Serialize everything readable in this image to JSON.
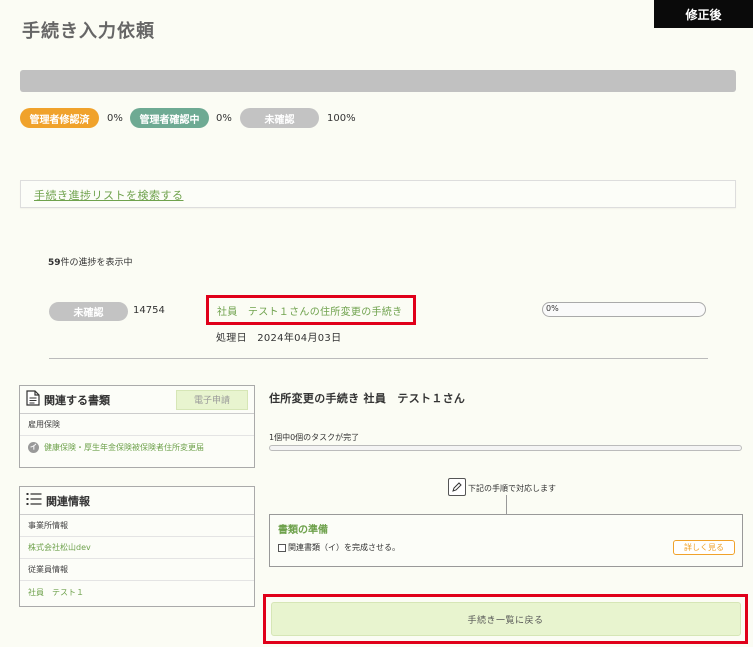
{
  "header": {
    "corner_label": "修正後",
    "page_title": "手続き入力依頼"
  },
  "progress": {
    "overall_fraction": 0,
    "statuses": [
      {
        "label": "管理者修認済",
        "percent": "0%",
        "color": "#f0a22b"
      },
      {
        "label": "管理者確認中",
        "percent": "0%",
        "color": "#6eaa93"
      },
      {
        "label": "未確認",
        "percent": "100%",
        "color": "#c3c3c3"
      }
    ]
  },
  "search": {
    "link_label": "手続き進捗リストを検索する"
  },
  "list": {
    "count": "59",
    "count_suffix": "件の進捗を表示中",
    "rows": [
      {
        "status": "未確認",
        "id": "14754",
        "title": "社員　テスト１さんの住所変更の手続き",
        "date": "処理日　2024年04月03日",
        "progress_label": "0%",
        "progress_fraction": 0
      }
    ]
  },
  "documents_panel": {
    "title": "関連する書類",
    "esign_label": "電子申請",
    "items": [
      {
        "label": "雇用保険",
        "style": "gray"
      },
      {
        "label": "健康保険・厚生年金保険被保険者住所変更届",
        "style": "green",
        "badge": "イ"
      }
    ]
  },
  "info_panel": {
    "title": "関連情報",
    "items": [
      {
        "label": "事業所情報",
        "style": "gray"
      },
      {
        "label": "株式会社松山dev",
        "style": "green"
      },
      {
        "label": "従業員情報",
        "style": "gray"
      },
      {
        "label": "社員　テスト１",
        "style": "green"
      }
    ]
  },
  "task": {
    "title": "住所変更の手続き  社員　テスト１さん",
    "count_text": "1個中0個のタスクが完了",
    "progress_fraction": 0,
    "instruction": "下記の手順で対応します",
    "step_title": "書類の準備",
    "step_text": "関連書類（イ）を完成させる。",
    "detail_label": "詳しく見る",
    "back_label": "手続き一覧に戻る"
  }
}
